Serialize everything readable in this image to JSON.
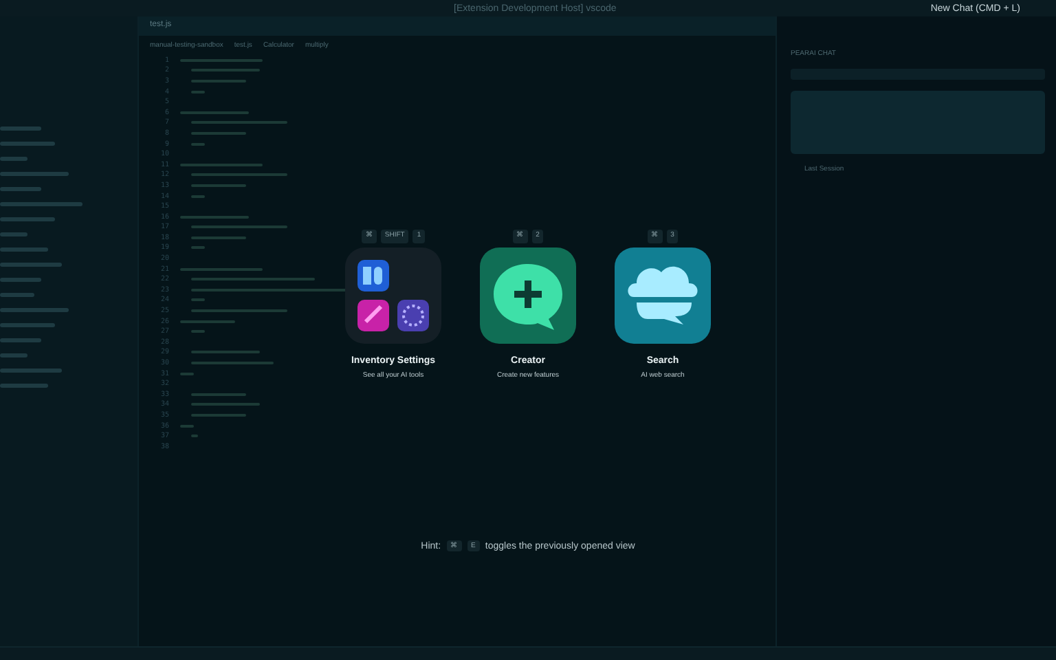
{
  "window": {
    "title": "[Extension Development Host] vscode",
    "new_chat": "New Chat (CMD + L)"
  },
  "editor": {
    "tab": "test.js",
    "breadcrumb": [
      "manual-testing-sandbox",
      "test.js",
      "Calculator",
      "multiply"
    ],
    "line_numbers": [
      "1",
      "2",
      "3",
      "4",
      "5",
      "6",
      "7",
      "8",
      "9",
      "10",
      "11",
      "12",
      "13",
      "14",
      "15",
      "16",
      "17",
      "18",
      "19",
      "20",
      "21",
      "22",
      "23",
      "24",
      "25",
      "26",
      "27",
      "28",
      "29",
      "30",
      "31",
      "32",
      "33",
      "34",
      "35",
      "36",
      "37",
      "38"
    ]
  },
  "chat": {
    "header": "PEARAI CHAT",
    "last_session": "Last Session"
  },
  "launcher": {
    "items": [
      {
        "kind": "folder",
        "keys": [
          "⌘",
          "SHIFT",
          "1"
        ],
        "title": "Inventory Settings",
        "subtitle": "See all your AI tools"
      },
      {
        "kind": "creator",
        "keys": [
          "⌘",
          "2"
        ],
        "title": "Creator",
        "subtitle": "Create new features"
      },
      {
        "kind": "search",
        "keys": [
          "⌘",
          "3"
        ],
        "title": "Search",
        "subtitle": "AI web search"
      }
    ],
    "hint": {
      "label": "Hint:",
      "keys": [
        "⌘",
        "E"
      ],
      "text": "toggles the previously opened view"
    }
  }
}
